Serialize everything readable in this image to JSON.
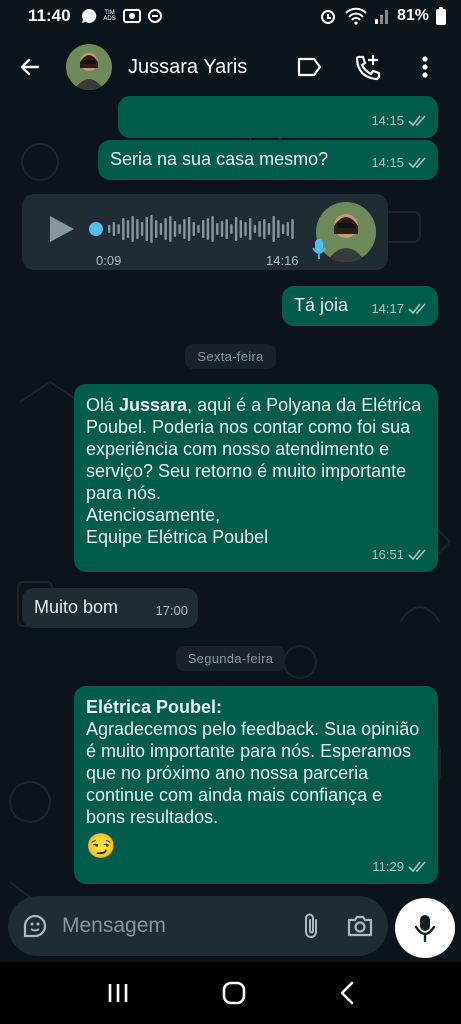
{
  "status_bar": {
    "time": "11:40",
    "carrier_label": "TIM\nADS",
    "battery": "81%"
  },
  "header": {
    "contact_name": "Jussara Yaris",
    "icons": [
      "back-arrow-icon",
      "label-icon",
      "add-call-icon",
      "more-vert-icon"
    ]
  },
  "messages": [
    {
      "type": "outgoing",
      "text": "",
      "time": "14:15",
      "status": "read"
    },
    {
      "type": "outgoing",
      "text": "Seria na sua casa mesmo?",
      "time": "14:15",
      "status": "read"
    },
    {
      "type": "incoming-audio",
      "duration": "0:09",
      "time": "14:16"
    },
    {
      "type": "outgoing",
      "text": "Tá joia",
      "time": "14:17",
      "status": "read"
    },
    {
      "type": "outgoing",
      "text_before": "Olá ",
      "bold": "Jussara",
      "text_after": ", aqui é a Polyana da Elétrica Poubel. Poderia nos contar como foi sua experiência com nosso atendimento e serviço? Seu retorno é muito importante para nós.\nAtenciosamente,\nEquipe Elétrica Poubel",
      "time": "16:51",
      "status": "read"
    },
    {
      "type": "incoming",
      "text": "Muito bom",
      "time": "17:00"
    },
    {
      "type": "outgoing",
      "bold": "Elétrica Poubel:",
      "text": "Agradecemos pelo feedback. Sua opinião é muito importante para nós. Esperamos que no próximo ano nossa parceria continue com ainda mais confiança e bons resultados.",
      "emoji": "😏",
      "time": "11:29",
      "status": "read"
    }
  ],
  "day_separators": [
    "Sexta-feira",
    "Segunda-feira"
  ],
  "input": {
    "placeholder": "Mensagem"
  },
  "colors": {
    "background": "#0b141a",
    "outgoing_bubble": "#005c4b",
    "incoming_bubble": "#202c33",
    "read_ticks": "#a7c2bc"
  }
}
